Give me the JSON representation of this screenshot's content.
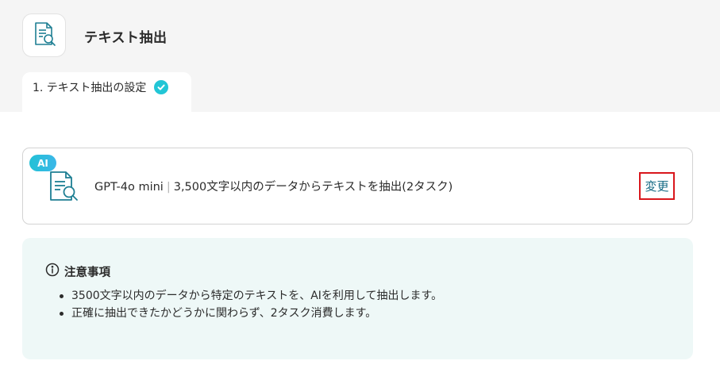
{
  "header": {
    "app_icon": "document-search-icon",
    "title": "テキスト抽出"
  },
  "tabs": [
    {
      "label": "1. テキスト抽出の設定",
      "status_icon": "check-circle-icon",
      "completed": true
    }
  ],
  "action_card": {
    "badge": "AI",
    "icon": "document-search-icon",
    "model": "GPT-4o mini",
    "separator": "|",
    "description": "3,500文字以内のデータからテキストを抽出(2タスク)",
    "change_label": "変更"
  },
  "notice": {
    "icon": "info-circle-icon",
    "title": "注意事項",
    "items": [
      "3500文字以内のデータから特定のテキストを、AIを利用して抽出します。",
      "正確に抽出できたかどうかに関わらず、2タスク消費します。"
    ]
  },
  "colors": {
    "accent": "#22c6d6",
    "icon_teal": "#1e7f93",
    "link": "#176b85",
    "highlight_border": "#d9161c",
    "notice_bg": "#eef8f7",
    "header_bg": "#f5f5f5"
  }
}
